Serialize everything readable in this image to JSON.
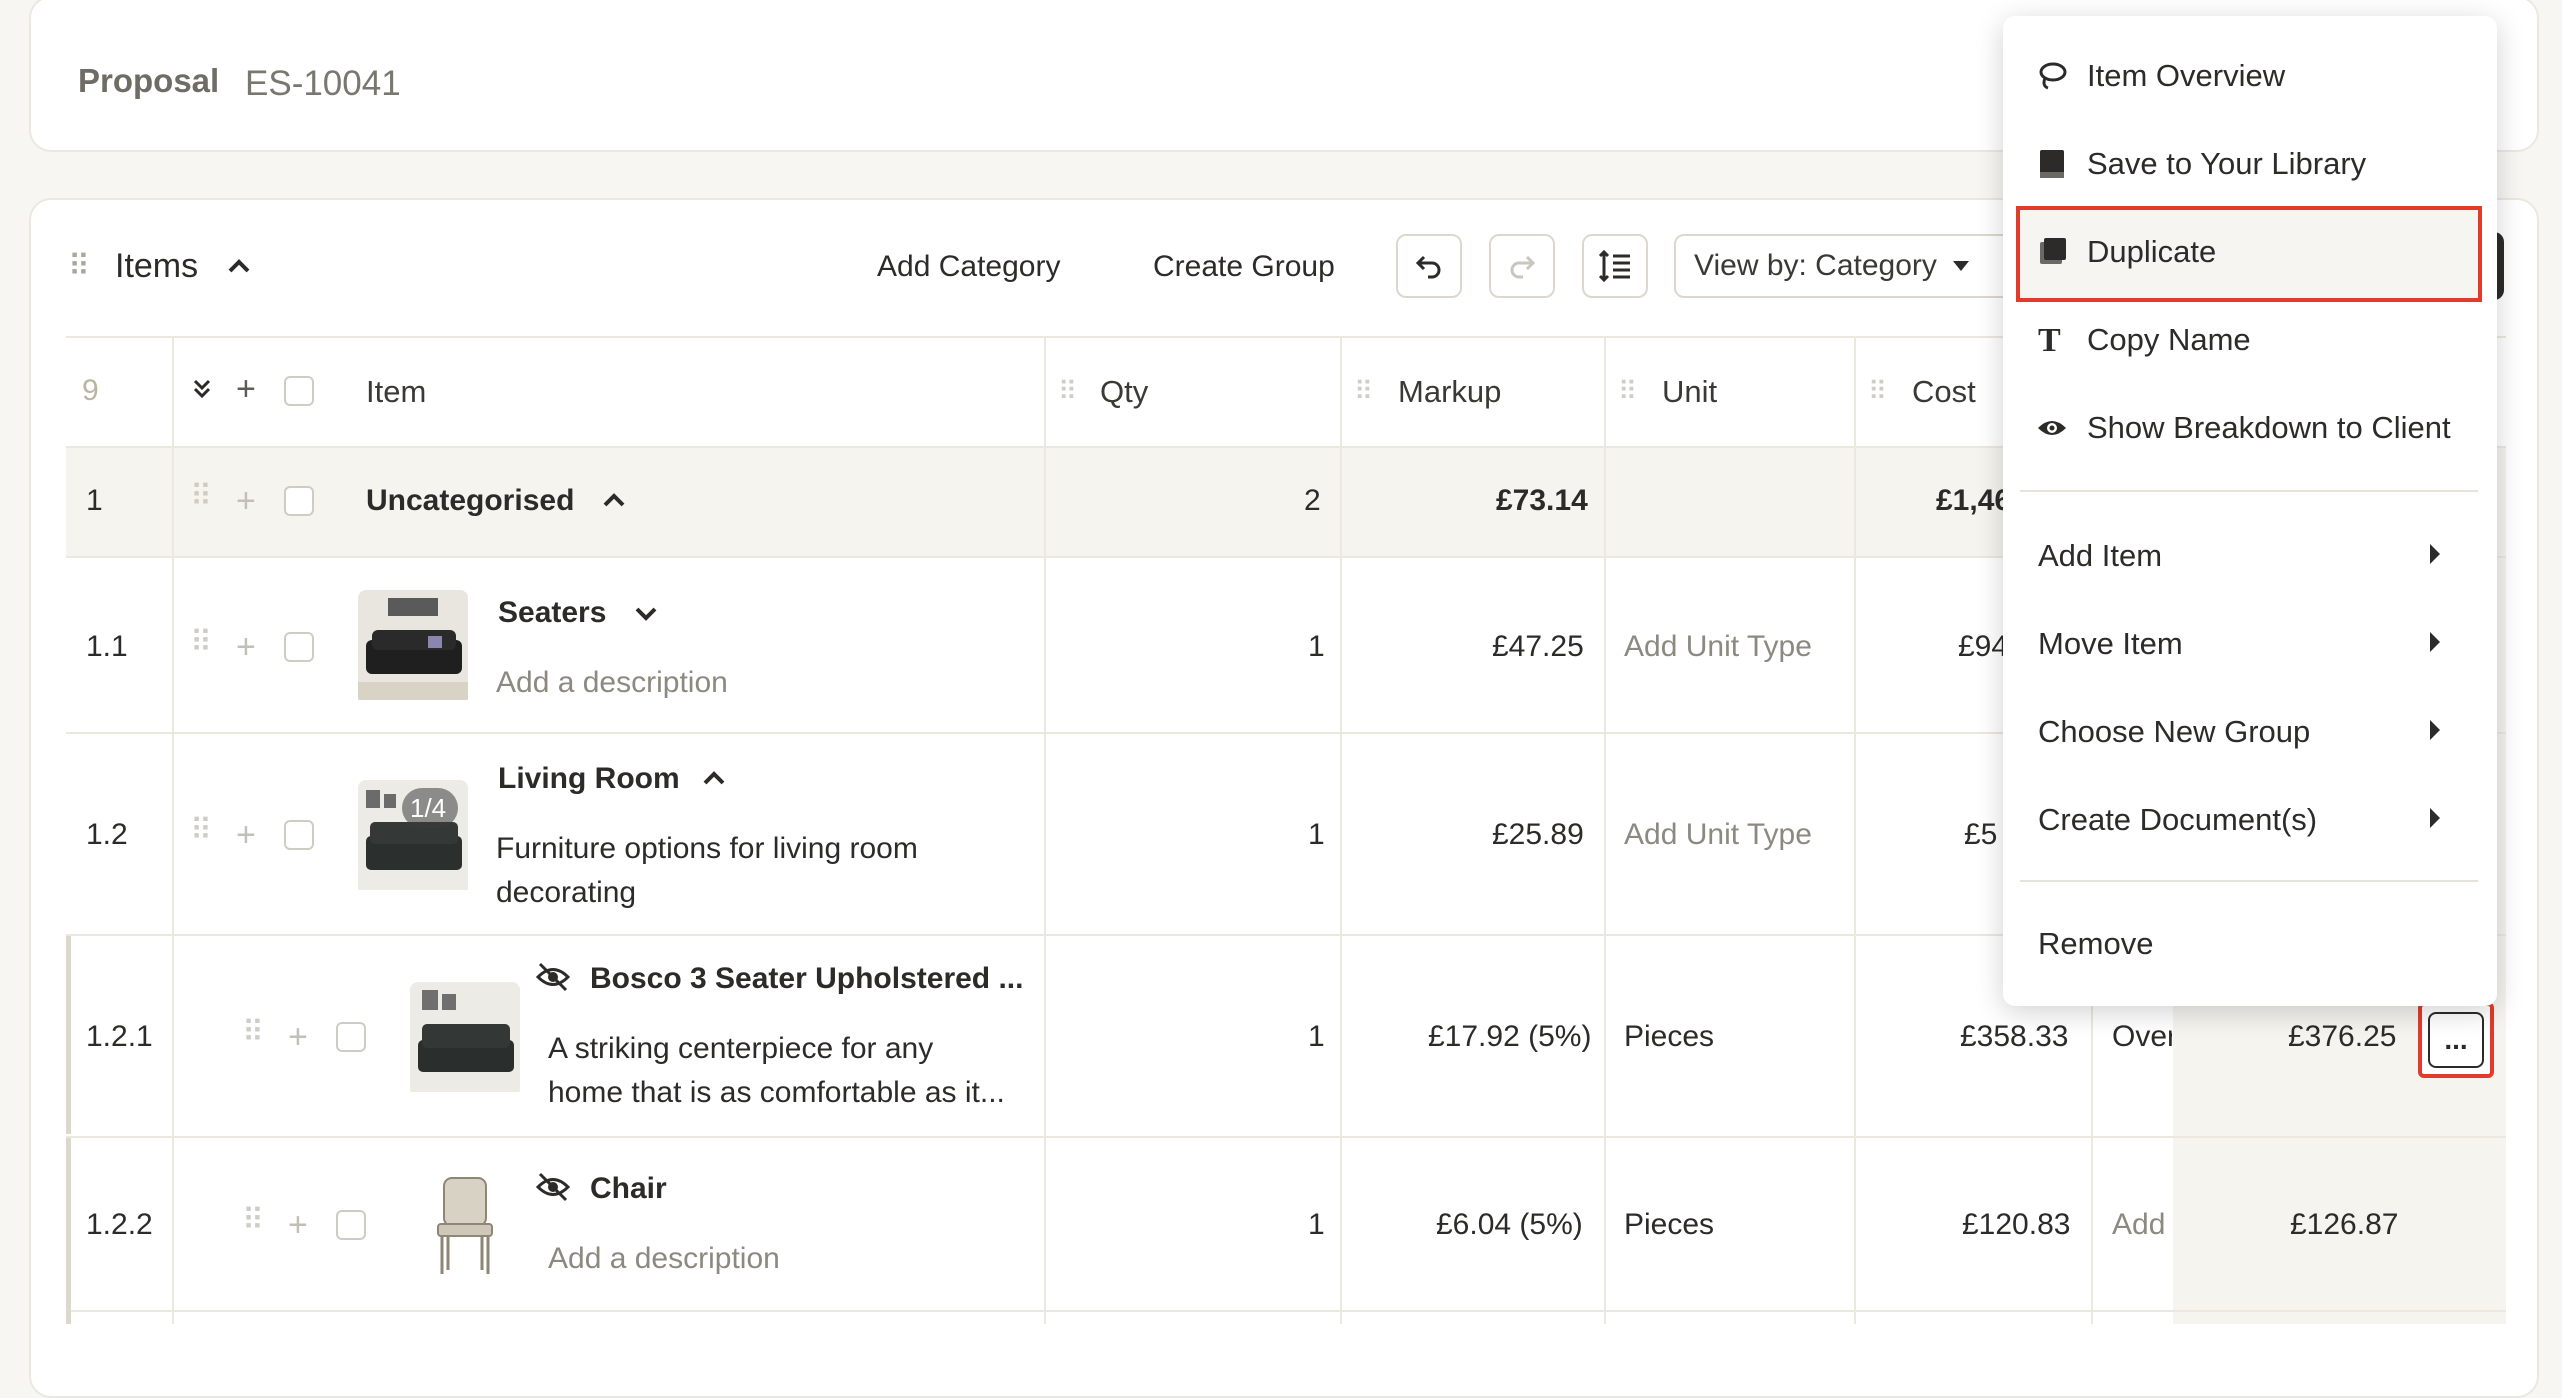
{
  "proposal": {
    "label": "Proposal",
    "number": "ES-10041"
  },
  "items_header": {
    "title": "Items",
    "add_category": "Add Category",
    "create_group": "Create Group",
    "view_by": "View by: Category"
  },
  "columns": {
    "count": "9",
    "item": "Item",
    "qty": "Qty",
    "markup": "Markup",
    "unit": "Unit",
    "cost": "Cost"
  },
  "rows": [
    {
      "num": "1",
      "name": "Uncategorised",
      "qty": "2",
      "markup": "£73.14",
      "cost": "£1,46"
    },
    {
      "num": "1.1",
      "name": "Seaters",
      "description": "Add a description",
      "qty": "1",
      "markup": "£47.25",
      "unit": "Add Unit Type",
      "cost": "£94"
    },
    {
      "num": "1.2",
      "name": "Living Room",
      "image_badge": "1/4",
      "description_line1": "Furniture options for living room",
      "description_line2": "decorating",
      "qty": "1",
      "markup": "£25.89",
      "unit": "Add Unit Type",
      "cost": "£5"
    },
    {
      "num": "1.2.1",
      "name": "Bosco 3 Seater Upholstered ...",
      "description_line1": "A striking centerpiece for any",
      "description_line2": "home that is as comfortable as it...",
      "qty": "1",
      "markup": "£17.92 (5%)",
      "unit": "Pieces",
      "cost": "£358.33",
      "extra": "Over",
      "total": "£376.25"
    },
    {
      "num": "1.2.2",
      "name": "Chair",
      "description": "Add a description",
      "qty": "1",
      "markup": "£6.04 (5%)",
      "unit": "Pieces",
      "cost": "£120.83",
      "extra": "Add",
      "total": "£126.87"
    }
  ],
  "menu": {
    "items": [
      {
        "label": "Item Overview",
        "icon": "lasso-icon"
      },
      {
        "label": "Save to Your Library",
        "icon": "library-icon"
      },
      {
        "label": "Duplicate",
        "icon": "duplicate-icon"
      },
      {
        "label": "Copy Name",
        "icon": "text-icon"
      },
      {
        "label": "Show Breakdown to Client",
        "icon": "eye-icon"
      }
    ],
    "submenus": [
      "Add Item",
      "Move Item",
      "Choose New Group",
      "Create Document(s)"
    ],
    "remove": "Remove"
  },
  "more_button": "..."
}
